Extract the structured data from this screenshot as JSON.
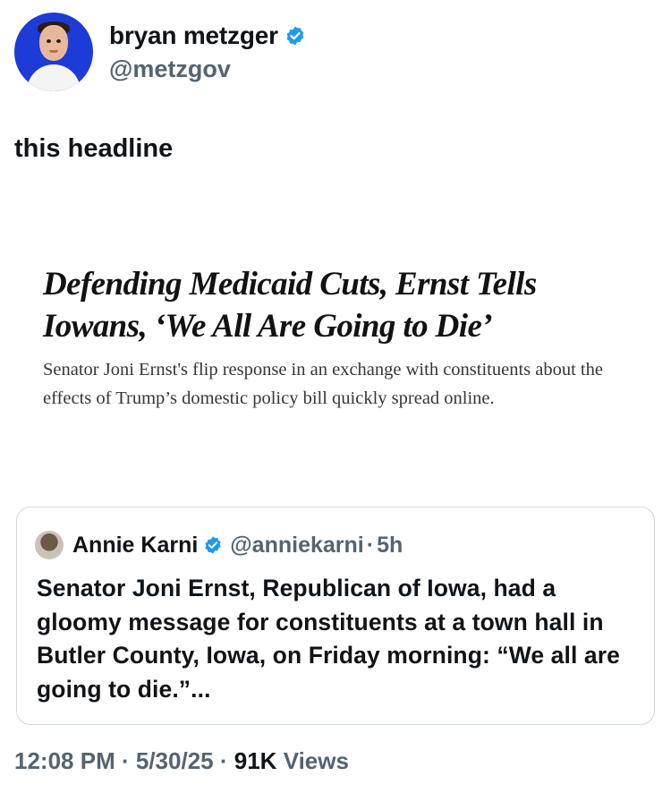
{
  "author": {
    "display_name": "bryan metzger",
    "handle": "@metzgov",
    "verified": true,
    "verified_color": "#1d9bf0"
  },
  "tweet": {
    "text": "this headline"
  },
  "article": {
    "headline": "Defending Medicaid Cuts, Ernst Tells Iowans, ‘We All Are Going to Die’",
    "summary": "Senator Joni Ernst's flip response in an exchange with constituents about the effects of Trump’s domestic policy bill quickly spread online."
  },
  "quoted_tweet": {
    "display_name": "Annie Karni",
    "handle": "@anniekarni",
    "separator": "·",
    "time": "5h",
    "verified": true,
    "text": "Senator Joni Ernst, Republican of Iowa, had a gloomy message for constituents at a town hall in Butler County, Iowa, on Friday morning: “We all are going to die.”..."
  },
  "meta": {
    "time": "12:08 PM",
    "separator": "·",
    "date": "5/30/25",
    "views_count": "91K",
    "views_label": "Views"
  }
}
